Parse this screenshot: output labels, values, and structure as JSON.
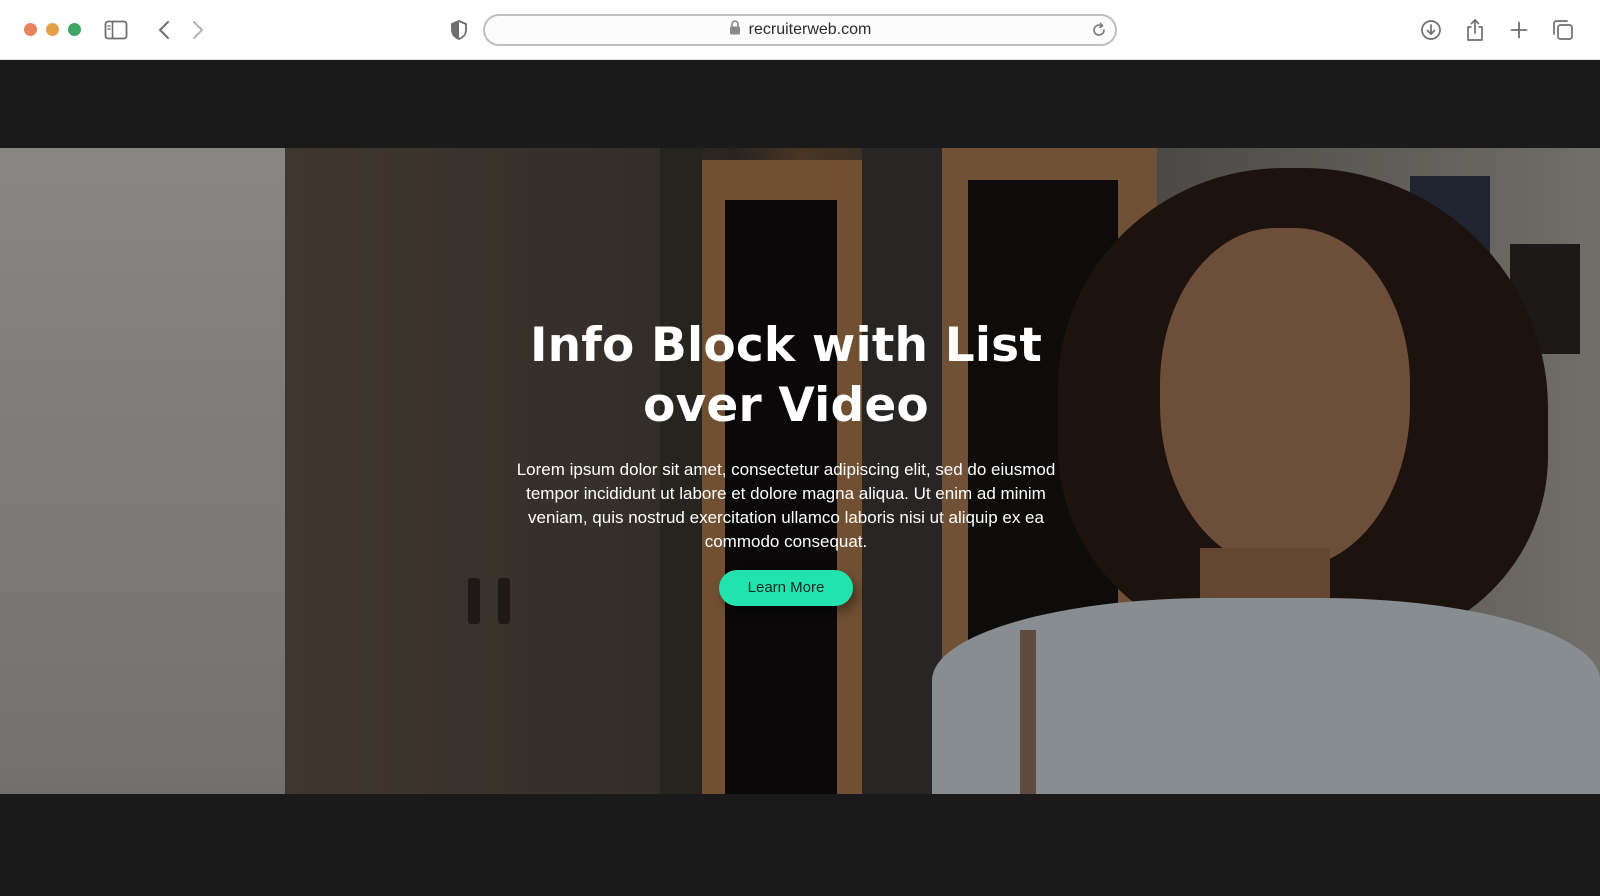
{
  "browser": {
    "url": "recruiterweb.com",
    "colors": {
      "close": "#e9835f",
      "minimize": "#e4a047",
      "maximize": "#3fa564"
    },
    "icons": [
      "sidebar-icon",
      "back-icon",
      "forward-icon",
      "shield-icon",
      "lock-icon",
      "reload-icon",
      "download-icon",
      "share-icon",
      "new-tab-icon",
      "tabs-overview-icon"
    ]
  },
  "hero": {
    "title": "Info Block with List over Video",
    "body": "Lorem ipsum dolor sit amet, consectetur adipiscing elit, sed do eiusmod tempor incididunt ut labore et dolore magna aliqua. Ut enim ad minim veniam, quis nostrud exercitation ullamco laboris nisi ut aliquip ex ea commodo consequat.",
    "cta_label": "Learn More",
    "colors": {
      "cta": "#22e3ad",
      "page_background": "#1a1a1a"
    }
  }
}
